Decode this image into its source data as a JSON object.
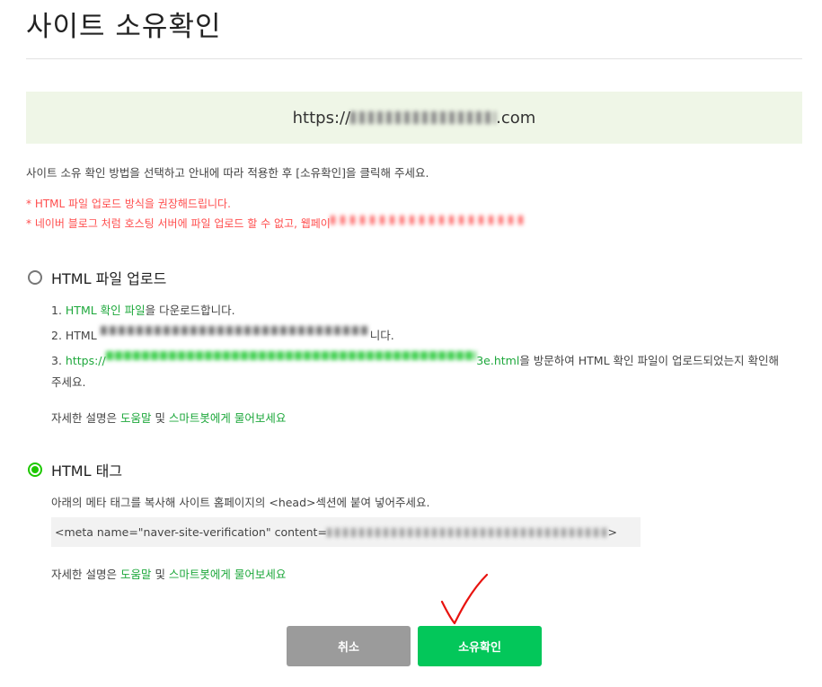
{
  "header": {
    "title": "사이트 소유확인"
  },
  "site": {
    "url_prefix": "https://",
    "url_hidden": "　　　　　　　　　",
    "url_suffix": ".com"
  },
  "instructions": {
    "main": "사이트 소유 확인 방법을 선택하고 안내에 따라 적용한 후 [소유확인]을 클릭해 주세요.",
    "warning1": "* HTML 파일 업로드 방식을 권장해드립니다.",
    "warning2": "* 네이버 블로그 처럼 호스팅 서버에 파일 업로드 할 수 없고, 웹페이",
    "warning2_hidden": "　　　　　　　　　　　　　　　　　　"
  },
  "options": {
    "html_file": {
      "label": "HTML 파일 업로드",
      "selected": false,
      "step1_num": "1. ",
      "step1_link": "HTML 확인 파일",
      "step1_text": "을 다운로드합니다.",
      "step2_prefix": "2. HTML ",
      "step2_hidden": "　　　　　　　　　　　　　　　　　　　　　　　　",
      "step2_suffix": "니다.",
      "step3_num": "3. ",
      "step3_link_prefix": "https://",
      "step3_link_hidden": "　　　　　　　　　　　　　　　　　　　　　　　　　　　　　　　　　",
      "step3_link_suffix": "3e.html",
      "step3_text": "을 방문하여 HTML 확인 파일이 업로드되었는지 확인해",
      "step3_text2": "주세요.",
      "help_prefix": "자세한 설명은 ",
      "help_link1": "도움말",
      "help_mid": " 및 ",
      "help_link2": "스마트봇에게 물어보세요"
    },
    "html_tag": {
      "label": "HTML 태그",
      "selected": true,
      "desc": "아래의 메타 태그를 복사해 사이트 홈페이지의 <head>섹션에 붙여 넣어주세요.",
      "meta_prefix": "<meta name=\"naver-site-verification\" content=",
      "meta_hidden": "　　　　　　　　　　　　　　　　　　　　　　　　　",
      "meta_suffix": ">",
      "help_prefix": "자세한 설명은 ",
      "help_link1": "도움말",
      "help_mid": " 및 ",
      "help_link2": "스마트봇에게 물어보세요"
    }
  },
  "buttons": {
    "cancel": "취소",
    "confirm": "소유확인"
  },
  "colors": {
    "accent": "#03c75a",
    "link": "#1ea83c",
    "warning": "#ff4d4d",
    "url_bg": "#eff6e7",
    "cancel_bg": "#9b9b9b"
  },
  "annotation": {
    "mark": "checkmark",
    "color": "#e8130f"
  }
}
